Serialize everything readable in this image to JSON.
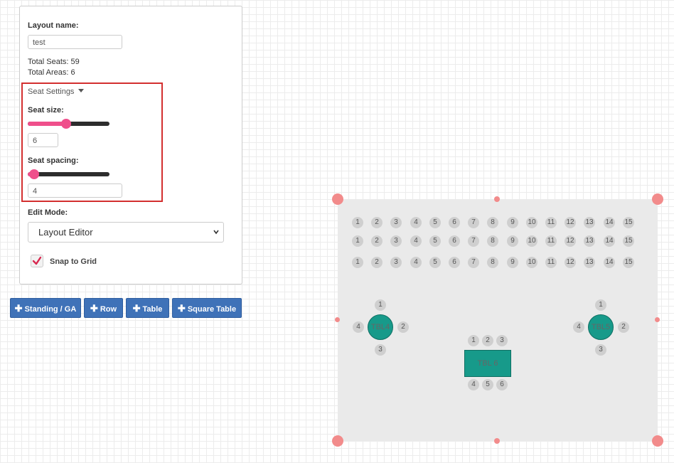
{
  "settings": {
    "layout_name_label": "Layout name:",
    "layout_name_value": "test",
    "total_seats": "Total Seats: 59",
    "total_areas": "Total Areas: 6",
    "seat_settings_label": "Seat Settings",
    "seat_size_label": "Seat size:",
    "seat_size_value": "6",
    "seat_size_fraction": 0.47,
    "seat_spacing_label": "Seat spacing:",
    "seat_spacing_value": "4",
    "seat_spacing_fraction": 0.08,
    "edit_mode_label": "Edit Mode:",
    "edit_mode_value": "Layout Editor",
    "snap_label": "Snap to Grid",
    "snap_checked": true
  },
  "buttons": {
    "standing": "Standing / GA",
    "row": "Row",
    "table": "Table",
    "square_table": "Square Table"
  },
  "colors": {
    "accent": "#3f72b8",
    "slider": "#ef4f8b",
    "table": "#179a8a",
    "highlight": "#d32f2f",
    "handle": "#f28b8b"
  },
  "floor": {
    "rows": [
      {
        "seats": [
          "1",
          "2",
          "3",
          "4",
          "5",
          "6",
          "7",
          "8",
          "9",
          "10",
          "11",
          "12",
          "13",
          "14",
          "15"
        ]
      },
      {
        "seats": [
          "1",
          "2",
          "3",
          "4",
          "5",
          "6",
          "7",
          "8",
          "9",
          "10",
          "11",
          "12",
          "13",
          "14",
          "15"
        ]
      },
      {
        "seats": [
          "1",
          "2",
          "3",
          "4",
          "5",
          "6",
          "7",
          "8",
          "9",
          "10",
          "11",
          "12",
          "13",
          "14",
          "15"
        ]
      }
    ],
    "tables": {
      "tbl4": {
        "label": "TBL4",
        "seats": [
          "1",
          "2",
          "3",
          "4"
        ]
      },
      "tbl5": {
        "label": "TBL5",
        "seats": [
          "1",
          "2",
          "3",
          "4"
        ]
      },
      "tbl6": {
        "label": "TBL 6",
        "top_seats": [
          "1",
          "2",
          "3"
        ],
        "bottom_seats": [
          "4",
          "5",
          "6"
        ]
      }
    }
  }
}
